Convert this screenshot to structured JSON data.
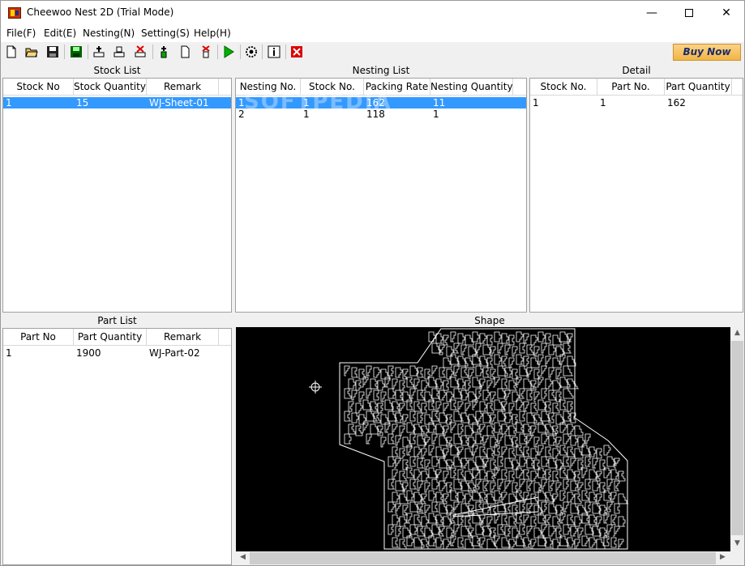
{
  "window": {
    "title": "Cheewoo Nest 2D (Trial Mode)",
    "minimize": "—",
    "close": "✕"
  },
  "menu": [
    {
      "label": "File(F)"
    },
    {
      "label": "Edit(E)"
    },
    {
      "label": "Nesting(N)"
    },
    {
      "label": "Setting(S)"
    },
    {
      "label": "Help(H)"
    }
  ],
  "toolbar": {
    "icons": [
      "new-file-icon",
      "open-folder-icon",
      "save-icon",
      "save-green-icon",
      "add-stock-icon",
      "edit-stock-icon",
      "delete-stock-icon",
      "add-part-icon",
      "edit-part-icon",
      "delete-part-icon",
      "run-nesting-icon",
      "settings-gear-icon",
      "info-icon",
      "exit-icon"
    ],
    "buy_label": "Buy Now"
  },
  "stock_list": {
    "title": "Stock List",
    "columns": [
      "Stock No",
      "Stock Quantity",
      "Remark"
    ],
    "rows": [
      {
        "no": "1",
        "qty": "15",
        "remark": "WJ-Sheet-01",
        "selected": true
      }
    ]
  },
  "nesting_list": {
    "title": "Nesting List",
    "columns": [
      "Nesting No.",
      "Stock No.",
      "Packing Rate",
      "Nesting Quantity"
    ],
    "rows": [
      {
        "nesting_no": "1",
        "stock_no": "1",
        "rate": "162",
        "qty": "11",
        "selected": true
      },
      {
        "nesting_no": "2",
        "stock_no": "1",
        "rate": "118",
        "qty": "1",
        "selected": false
      }
    ],
    "watermark": "SOFTPEDIA"
  },
  "detail": {
    "title": "Detail",
    "columns": [
      "Stock No.",
      "Part No.",
      "Part Quantity"
    ],
    "rows": [
      {
        "stock_no": "1",
        "part_no": "1",
        "qty": "162"
      }
    ]
  },
  "part_list": {
    "title": "Part List",
    "columns": [
      "Part No",
      "Part Quantity",
      "Remark"
    ],
    "rows": [
      {
        "no": "1",
        "qty": "1900",
        "remark": "WJ-Part-02"
      }
    ]
  },
  "shape": {
    "title": "Shape",
    "background": "#000000",
    "stroke": "#ffffff"
  },
  "colors": {
    "selection": "#3399ff",
    "buy_button": "#f2b545"
  }
}
